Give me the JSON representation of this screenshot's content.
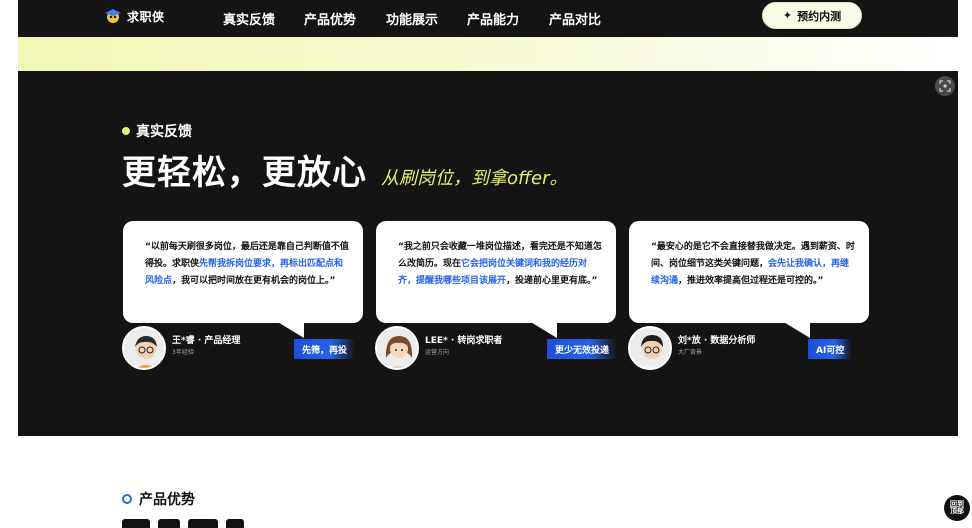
{
  "nav": {
    "logo_text": "求职侠",
    "links": [
      "真实反馈",
      "产品优势",
      "功能展示",
      "产品能力",
      "产品对比"
    ],
    "cta_label": "预约内测"
  },
  "feedback": {
    "tag": "真实反馈",
    "title": "更轻松，更放心",
    "subtitle": "从刷岗位，到拿offer。",
    "cards": [
      {
        "quote_pre": "“以前每天刷很多岗位，最后还是靠自己判断值不值得投。求职侠",
        "quote_hl": "先帮我拆岗位要求，再标出匹配点和风险点",
        "quote_post": "，我可以把时间放在更有机会的岗位上。”",
        "name": "王*睿 · 产品经理",
        "sub": "3年经验",
        "badge": "先筛，再投"
      },
      {
        "quote_pre": "“我之前只会收藏一堆岗位描述，看完还是不知道怎么改简历。现在",
        "quote_hl": "它会把岗位关键词和我的经历对齐，提醒我哪些项目该展开",
        "quote_post": "，投递前心里更有底。”",
        "name": "LEE* · 转岗求职者",
        "sub": "运营方向",
        "badge": "更少无效投递"
      },
      {
        "quote_pre": "“最安心的是它不会直接替我做决定。遇到薪资、时间、岗位细节这类关键问题，",
        "quote_hl": "会先让我确认，再继续沟通",
        "quote_post": "，推进效率提高但过程还是可控的。”",
        "name": "刘*放 · 数据分析师",
        "sub": "大厂背景",
        "badge": "AI可控"
      }
    ]
  },
  "advantages": {
    "tag": "产品优势"
  },
  "float_button": "回到顶部",
  "colors": {
    "dark_bg": "#141414",
    "accent_yellow": "#e6f06c",
    "highlight_blue": "#2563eb",
    "tag_dot_blue": "#1d6fe0"
  }
}
